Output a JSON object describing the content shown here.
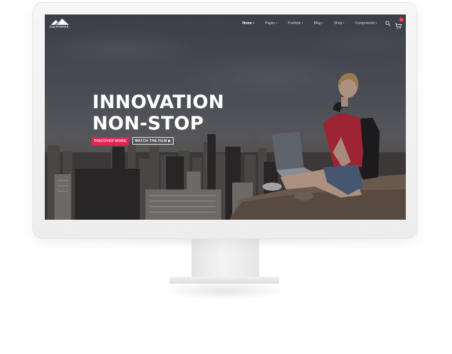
{
  "site": {
    "logo_text": "CALIFORNIA"
  },
  "nav": {
    "items": [
      {
        "label": "Home •"
      },
      {
        "label": "Pages •"
      },
      {
        "label": "Portfolio •"
      },
      {
        "label": "Blog •"
      },
      {
        "label": "Shop •"
      },
      {
        "label": "Components •"
      }
    ],
    "active_index": 0,
    "search_icon": "search-icon",
    "cart_icon": "cart-icon",
    "cart_count": "0"
  },
  "hero": {
    "headline_line1": "INNOVATION",
    "headline_line2": "NON-STOP",
    "primary_button": "DISCOVER MORE",
    "secondary_button": "WATCH THE FILM ▶"
  },
  "colors": {
    "accent": "#e8234f",
    "text_light": "#ffffff"
  }
}
